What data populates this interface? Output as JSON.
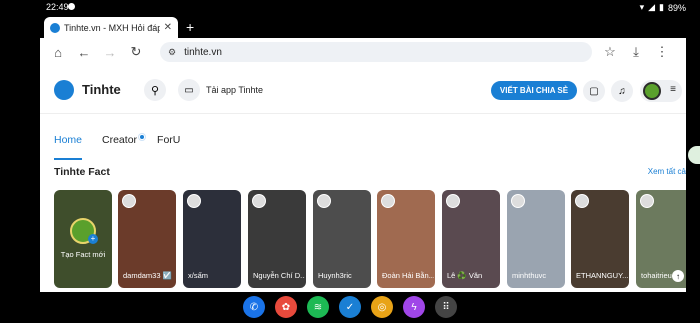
{
  "status_bar": {
    "time": "22:49",
    "battery": "89%"
  },
  "browser": {
    "tab_title": "Tinhte.vn - MXH Hỏi đáp, Re",
    "tab_close": "✕",
    "new_tab": "+",
    "url": "tinhte.vn"
  },
  "site": {
    "logo_text": "Tinhte",
    "app_label": "Tải app Tinhte",
    "write_button": "VIẾT BÀI CHIA SẺ",
    "nav_tabs": [
      "Home",
      "Creator",
      "ForU"
    ],
    "section_title": "Tinhte Fact",
    "see_all": "Xem tất cả",
    "create_card_label": "Tạo Fact mới",
    "cards": [
      {
        "name": "damdam33 ☑️",
        "color": "#6b3b2a"
      },
      {
        "name": "x/sấm",
        "color": "#2c2f3a"
      },
      {
        "name": "Nguyễn Chí D...",
        "color": "#3a3a3a"
      },
      {
        "name": "Huynh3ric",
        "color": "#4d4d4d"
      },
      {
        "name": "Đoàn Hải Bằn...",
        "color": "#a06a50"
      },
      {
        "name": "Lê ♻️ Văn",
        "color": "#5a4a50"
      },
      {
        "name": "minhthuvc",
        "color": "#9aa4b0"
      },
      {
        "name": "ETHANNGUY...",
        "color": "#4a3c30"
      },
      {
        "name": "tohaitrieu",
        "color": "#6c7a5e"
      }
    ]
  },
  "dock": [
    {
      "icon": "phone-icon",
      "color": "#1a73e8"
    },
    {
      "icon": "photos-icon",
      "color": "#e84a3c"
    },
    {
      "icon": "spotify-icon",
      "color": "#1db954"
    },
    {
      "icon": "tinhte-icon",
      "color": "#1a7fd4"
    },
    {
      "icon": "chrome-icon",
      "color": "#e8a317"
    },
    {
      "icon": "messenger-icon",
      "color": "#a046e8"
    },
    {
      "icon": "apps-icon",
      "color": "#444444"
    }
  ]
}
